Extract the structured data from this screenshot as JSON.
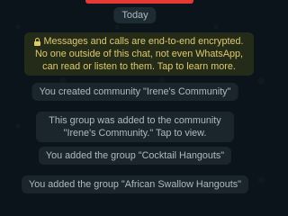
{
  "chat": {
    "day_label": "Today",
    "encryption_notice": "Messages and calls are end-to-end encrypted. No one outside of this chat, not even WhatsApp, can read or listen to them. Tap to learn more.",
    "system_messages": [
      "You created community \"Irene's Community\"",
      "This group was added to the community \"Irene's Community.\" Tap to view.",
      "You added the group \"Cocktail Hangouts\"",
      "You added the group \"African Swallow Hangouts\""
    ]
  },
  "colors": {
    "background": "#0b141a",
    "notice_text": "#e0c96b",
    "system_text": "#aebac1",
    "accent_strip": "#e53935"
  },
  "icons": {
    "encryption_notice": "lock-icon"
  }
}
